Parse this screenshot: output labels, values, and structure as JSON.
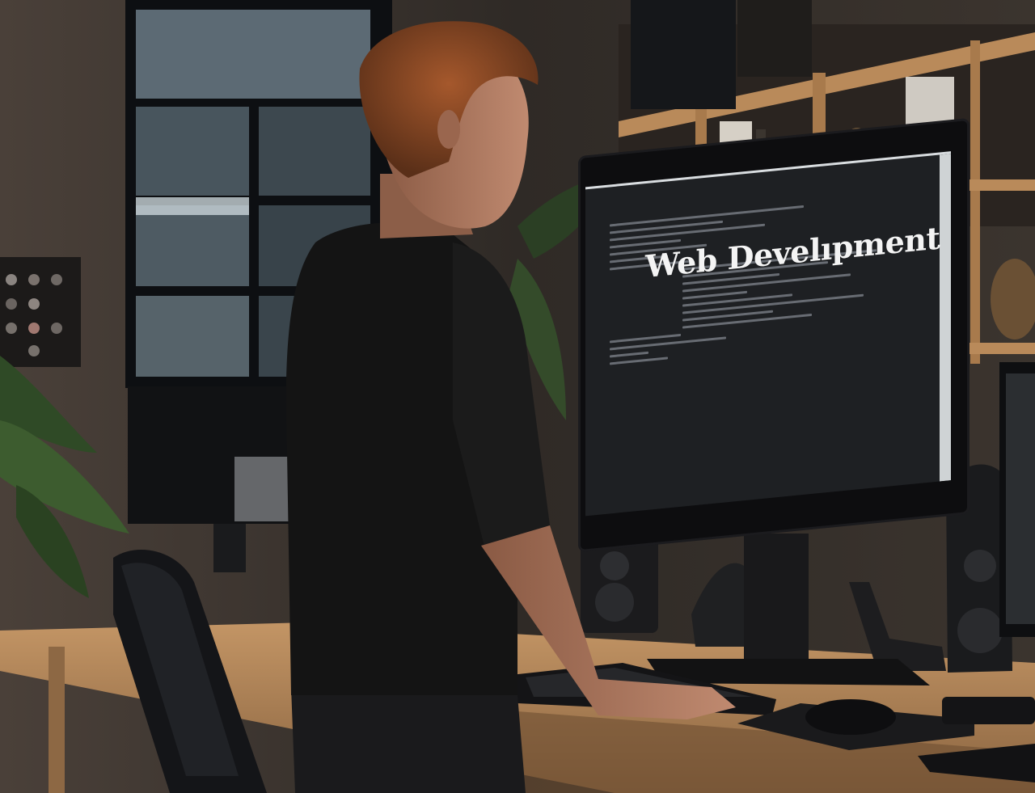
{
  "photo": {
    "screen_text": "Web Develıpment"
  },
  "colors": {
    "wall": "#3a322b",
    "shirt": "#161616",
    "desk": "#b08656",
    "screen": "#1e2023"
  }
}
